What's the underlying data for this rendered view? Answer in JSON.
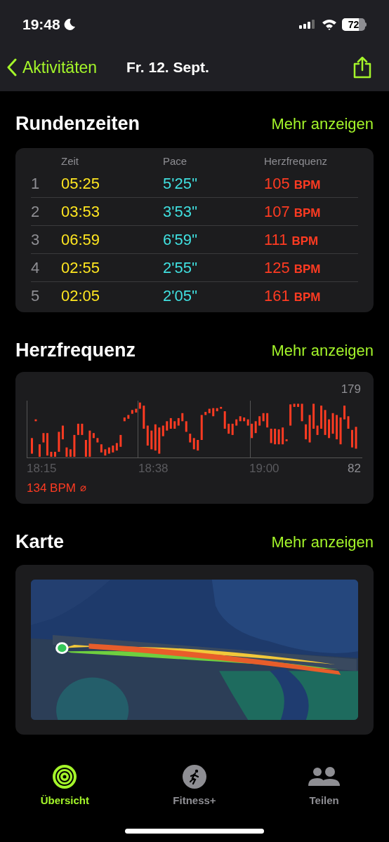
{
  "status_bar": {
    "time": "19:48",
    "battery": "72"
  },
  "nav": {
    "back": "Aktivitäten",
    "title": "Fr. 12. Sept."
  },
  "laps": {
    "title": "Rundenzeiten",
    "more": "Mehr anzeigen",
    "columns": [
      "Zeit",
      "Pace",
      "Herzfrequenz"
    ],
    "rows": [
      {
        "number": "1",
        "time": "05:25",
        "pace": "5'25''",
        "hr": "105",
        "unit": "BPM"
      },
      {
        "number": "2",
        "time": "03:53",
        "pace": "3'53''",
        "hr": "107",
        "unit": "BPM"
      },
      {
        "number": "3",
        "time": "06:59",
        "pace": "6'59''",
        "hr": "111",
        "unit": "BPM"
      },
      {
        "number": "4",
        "time": "02:55",
        "pace": "2'55''",
        "hr": "125",
        "unit": "BPM"
      },
      {
        "number": "5",
        "time": "02:05",
        "pace": "2'05''",
        "hr": "161",
        "unit": "BPM"
      }
    ]
  },
  "heart": {
    "title": "Herzfrequenz",
    "more": "Mehr anzeigen",
    "max": "179",
    "min": "82",
    "times": [
      "18:15",
      "18:38",
      "19:00"
    ],
    "average": "134 BPM",
    "average_symbol": "⌀"
  },
  "map": {
    "title": "Karte",
    "more": "Mehr anzeigen",
    "kind": "picture"
  },
  "tabs": [
    {
      "label": "Übersicht",
      "selected": true,
      "kind": "rings"
    },
    {
      "label": "Fitness+",
      "selected": false,
      "kind": "runner"
    },
    {
      "label": "Teilen",
      "selected": false,
      "kind": "people"
    }
  ]
}
